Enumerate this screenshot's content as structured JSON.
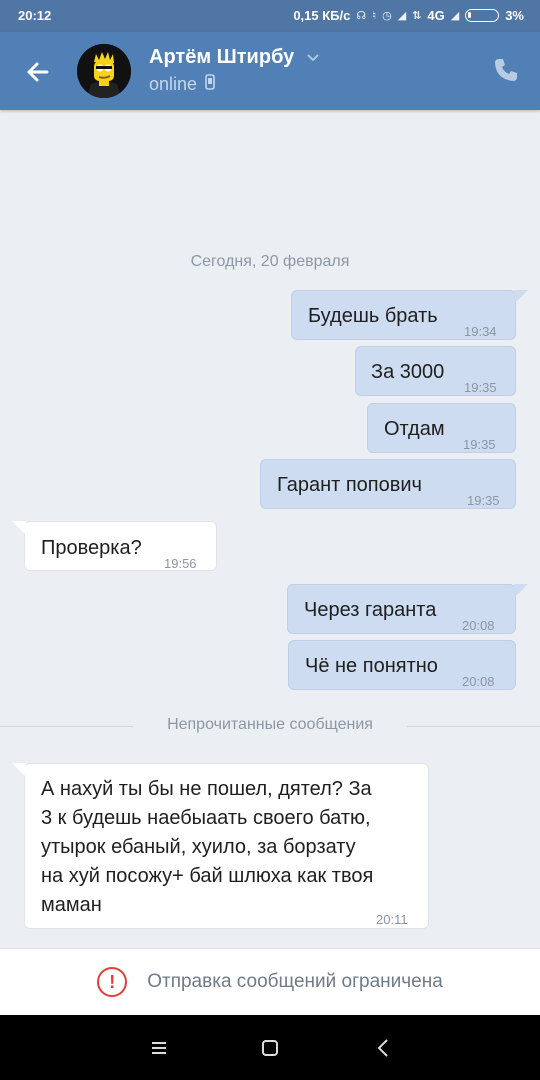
{
  "status_bar": {
    "time": "20:12",
    "network_speed": "0,15 КБ/с",
    "network_type": "4G",
    "battery": "3%",
    "icons": [
      "headphones-icon",
      "mute-icon",
      "alarm-icon",
      "signal-icon",
      "data-arrows-icon",
      "signal-icon",
      "battery-icon"
    ]
  },
  "header": {
    "contact_name": "Артём Штирбу",
    "presence": "online",
    "icons": [
      "back-arrow-icon",
      "chevron-down-icon",
      "mobile-device-icon",
      "phone-call-icon"
    ]
  },
  "chat": {
    "date_separator": "Сегодня, 20 февраля",
    "unread_separator": "Непрочитанные сообщения",
    "messages": [
      {
        "direction": "out",
        "text": "Будешь брать",
        "time": "19:34"
      },
      {
        "direction": "out",
        "text": "За 3000",
        "time": "19:35"
      },
      {
        "direction": "out",
        "text": "Отдам",
        "time": "19:35"
      },
      {
        "direction": "out",
        "text": "Гарант попович",
        "time": "19:35"
      },
      {
        "direction": "in",
        "text": "Проверка?",
        "time": "19:56"
      },
      {
        "direction": "out",
        "text": "Через гаранта",
        "time": "20:08"
      },
      {
        "direction": "out",
        "text": "Чё не понятно",
        "time": "20:08"
      },
      {
        "direction": "in",
        "text_lines": [
          "А нахуй ты бы не пошел, дятел? За",
          "3 к будешь наебыаать своего батю,",
          "утырок ебаный, хуило, за борзату",
          "на хуй посожу+ бай шлюха как твоя",
          "маман"
        ],
        "time": "20:11"
      }
    ]
  },
  "restriction": {
    "label": "Отправка сообщений ограничена",
    "icon": "warning-icon"
  },
  "nav_bar": {
    "icons": [
      "menu-icon",
      "home-icon",
      "back-icon"
    ]
  },
  "colors": {
    "header": "#5180b6",
    "status_bar": "#4f76a4",
    "chat_bg": "#ebeff4",
    "outgoing_bubble": "#cddcf0",
    "incoming_bubble": "#ffffff",
    "warning": "#e0403a"
  }
}
